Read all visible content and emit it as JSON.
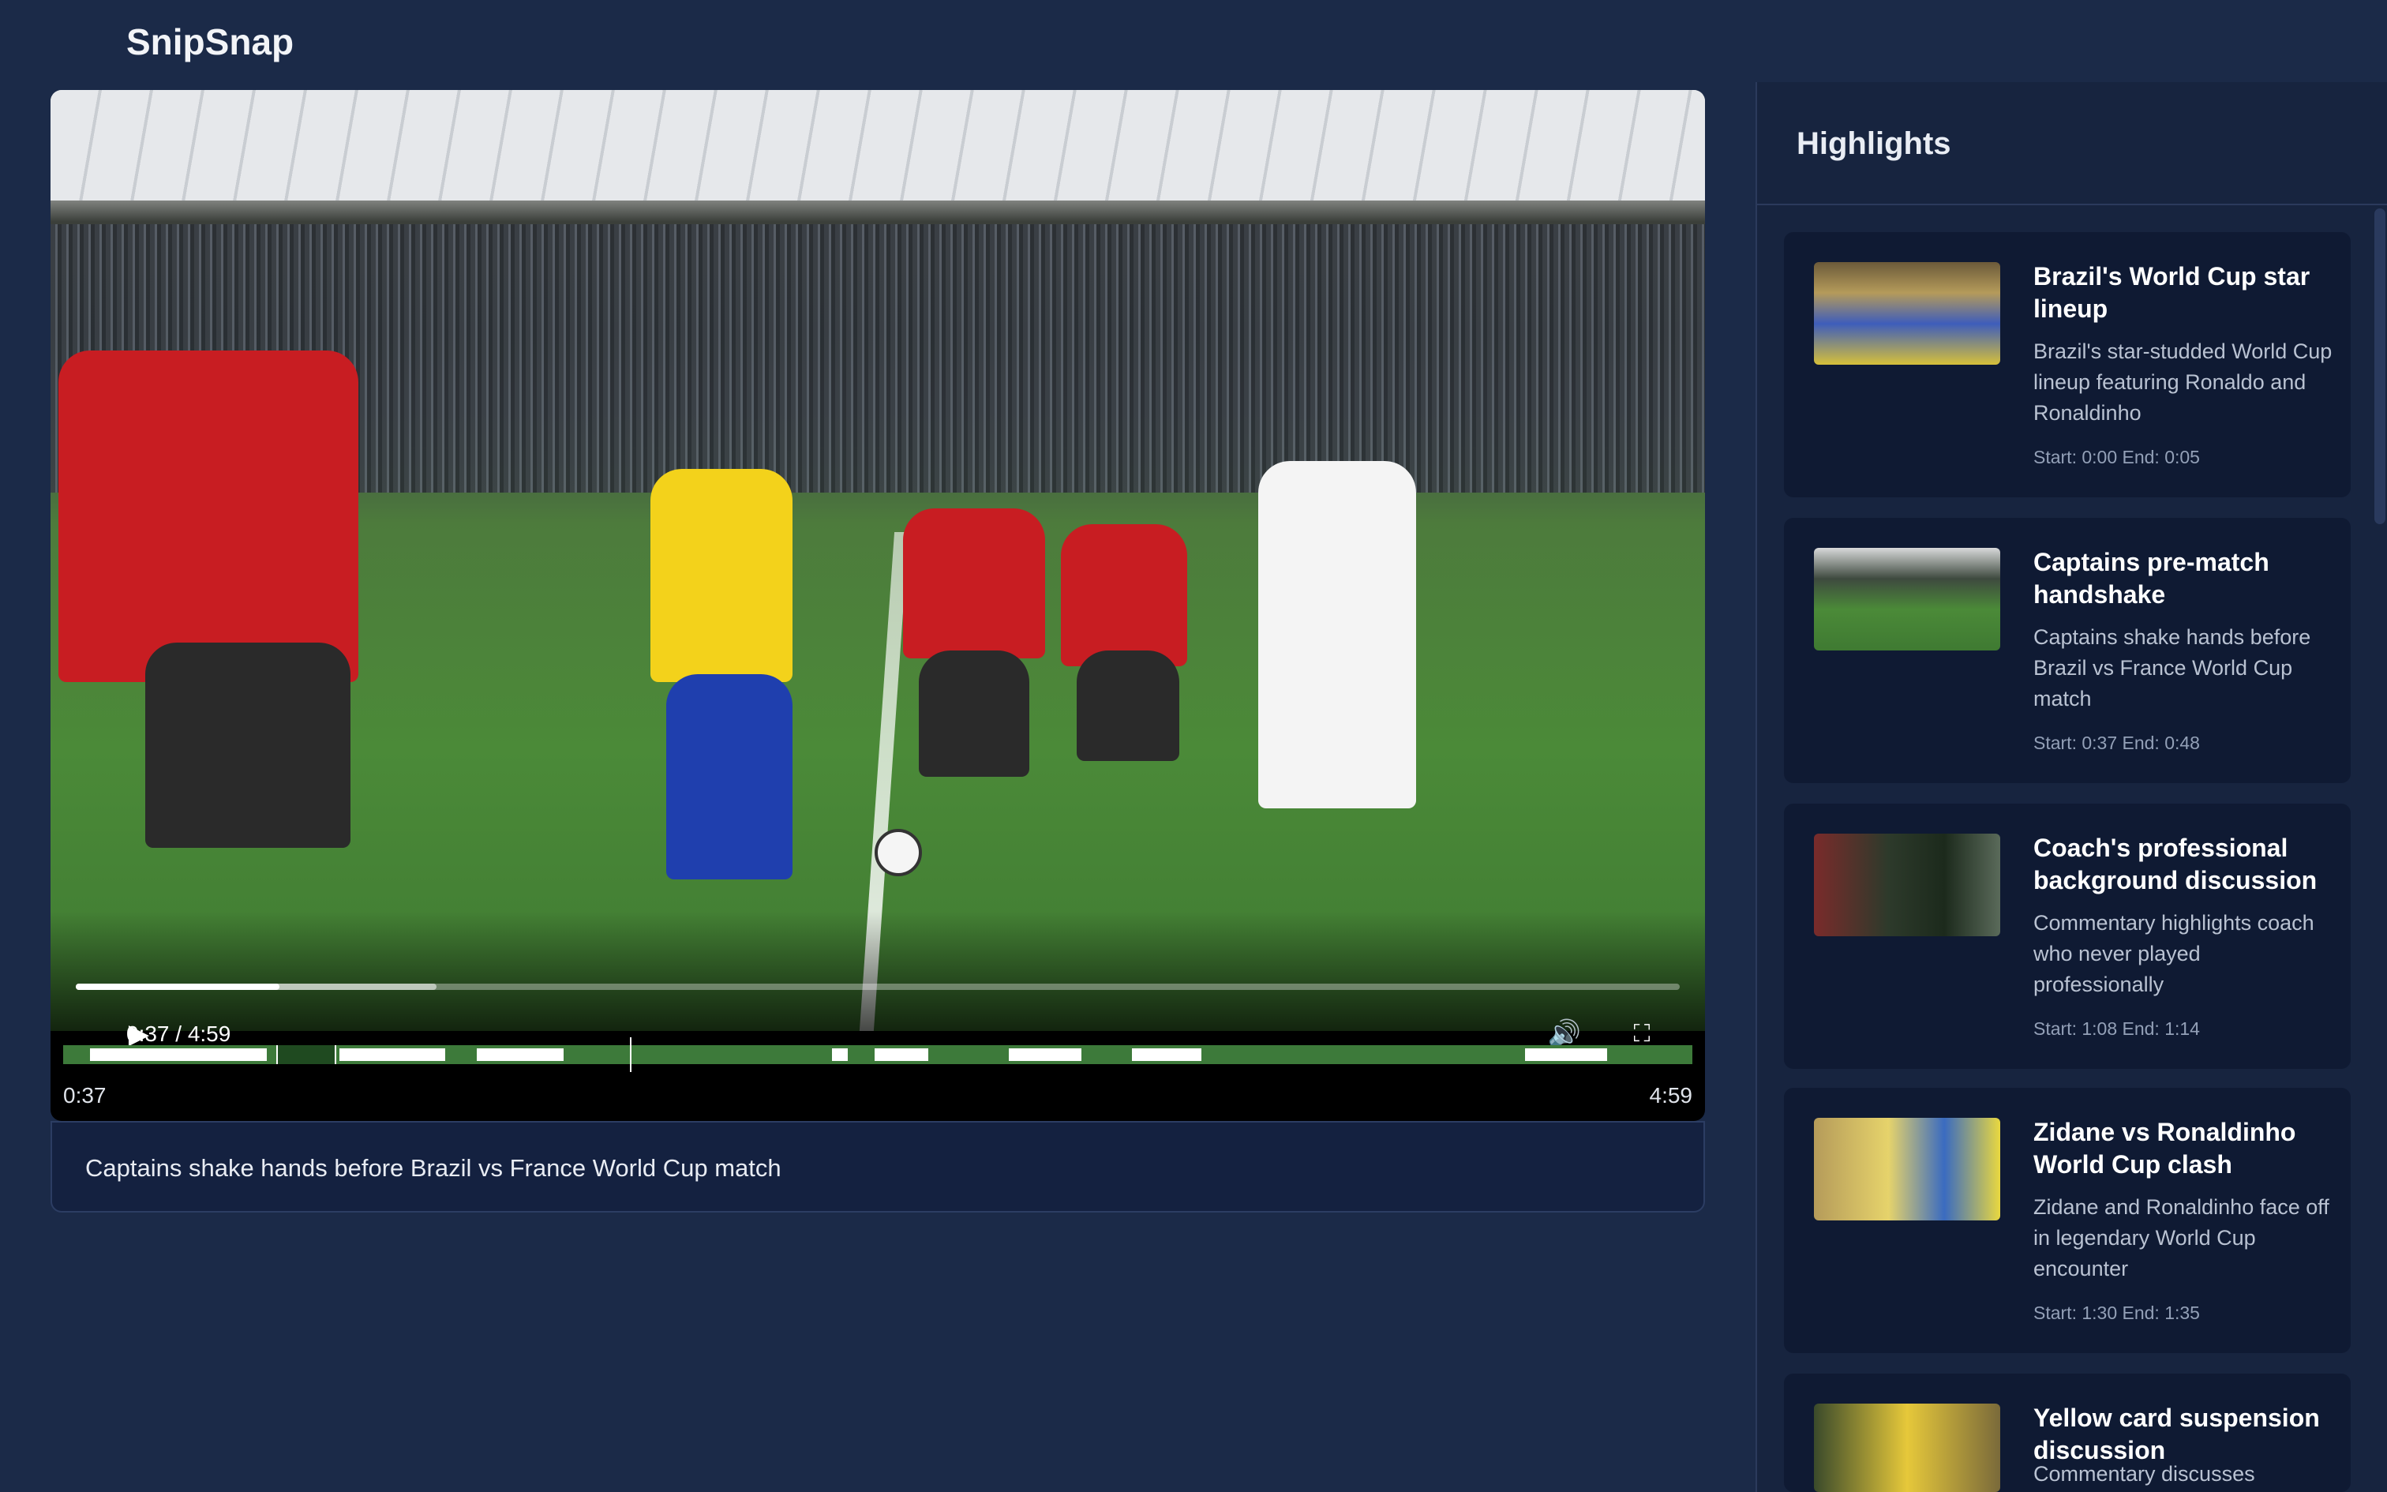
{
  "app": {
    "brand": "SnipSnap"
  },
  "player": {
    "time_readout": "0:37 / 4:59",
    "progress_played_fraction": 0.127,
    "progress_buffered_fraction": 0.225,
    "icons": {
      "play": "play-icon",
      "volume": "volume-icon",
      "fullscreen": "fullscreen-icon",
      "more": "more-vertical-icon"
    }
  },
  "timeline": {
    "start_label": "0:37",
    "end_label": "4:59"
  },
  "caption": {
    "text": "Captains shake hands before Brazil vs France World Cup match"
  },
  "sidebar": {
    "title": "Highlights",
    "items": [
      {
        "title": "Brazil's World Cup star lineup",
        "description": "Brazil's star-studded World Cup lineup featuring Ronaldo and Ronaldinho",
        "time": "Start: 0:00 End: 0:05"
      },
      {
        "title": "Captains pre-match handshake",
        "description": "Captains shake hands before Brazil vs France World Cup match",
        "time": "Start: 0:37 End: 0:48"
      },
      {
        "title": "Coach's professional background discussion",
        "description": "Commentary highlights coach who never played professionally",
        "time": "Start: 1:08 End: 1:14"
      },
      {
        "title": "Zidane vs Ronaldinho World Cup clash",
        "description": "Zidane and Ronaldinho face off in legendary World Cup encounter",
        "time": "Start: 1:30 End: 1:35"
      },
      {
        "title": "Yellow card suspension discussion",
        "description": "Commentary discusses",
        "time": ""
      }
    ]
  },
  "colors": {
    "background": "#1b2a48",
    "card": "#0f1a33",
    "timeline_green": "#3d7a3a"
  }
}
